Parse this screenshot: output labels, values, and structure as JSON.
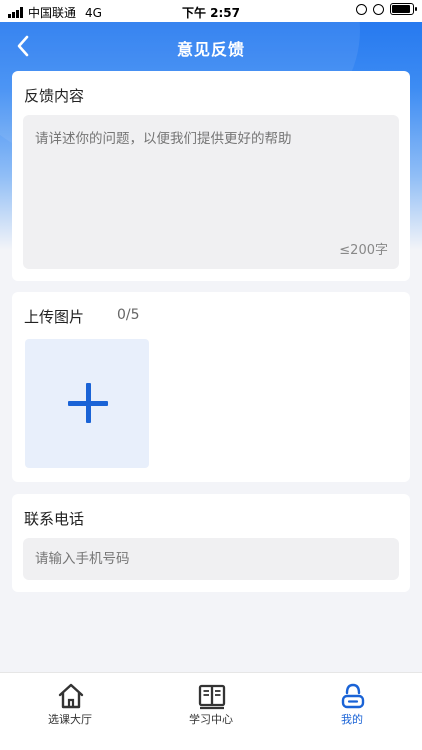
{
  "status_bar": {
    "carrier": "中国联通",
    "network": "4G",
    "time": "下午 2:57"
  },
  "nav": {
    "title": "意见反馈",
    "back_icon": "chevron-left-icon"
  },
  "feedback": {
    "title": "反馈内容",
    "placeholder": "请详述你的问题，以便我们提供更好的帮助",
    "limit": "≤200字"
  },
  "upload": {
    "title": "上传图片",
    "count": "0/5",
    "add_icon": "plus-icon"
  },
  "contact": {
    "title": "联系电话",
    "placeholder": "请输入手机号码"
  },
  "tabbar": {
    "items": [
      {
        "label": "选课大厅",
        "icon": "home-icon",
        "active": false
      },
      {
        "label": "学习中心",
        "icon": "book-icon",
        "active": false
      },
      {
        "label": "我的",
        "icon": "profile-icon",
        "active": true
      }
    ]
  },
  "colors": {
    "accent": "#1a63d6",
    "header_gradient_top": "#1f73ee",
    "background": "#f3f4f8"
  }
}
